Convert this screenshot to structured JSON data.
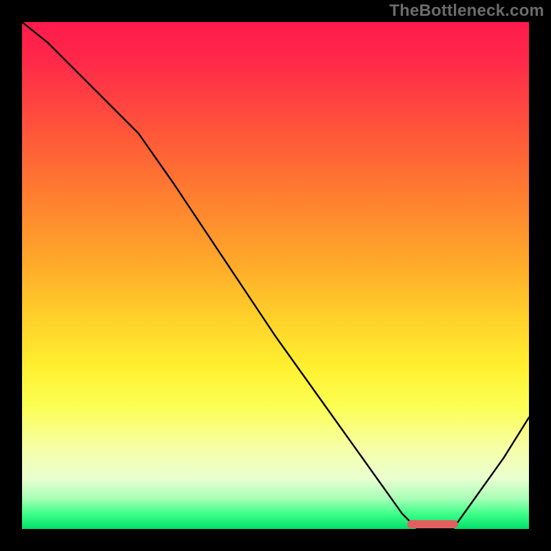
{
  "watermark": "TheBottleneck.com",
  "chart_data": {
    "type": "line",
    "title": "",
    "xlabel": "",
    "ylabel": "",
    "xlim": [
      0,
      100
    ],
    "ylim": [
      0,
      100
    ],
    "grid": false,
    "legend": null,
    "series": [
      {
        "name": "bottleneck-curve",
        "x": [
          0,
          5,
          10,
          15,
          20,
          23,
          30,
          40,
          50,
          60,
          70,
          75,
          78,
          82,
          85,
          90,
          95,
          100
        ],
        "y": [
          100,
          96,
          91,
          86,
          81,
          78,
          68,
          53,
          38,
          24,
          10,
          3,
          0,
          0,
          0,
          7,
          14,
          22
        ]
      }
    ],
    "marker": {
      "name": "optimal-range",
      "x_start": 76,
      "x_end": 86,
      "y": 0,
      "color": "#e06060"
    },
    "gradient_stops": [
      {
        "pos": 0,
        "color": "#ff1a4d"
      },
      {
        "pos": 50,
        "color": "#ffd52f"
      },
      {
        "pos": 85,
        "color": "#f8ffb0"
      },
      {
        "pos": 100,
        "color": "#00e06a"
      }
    ]
  }
}
